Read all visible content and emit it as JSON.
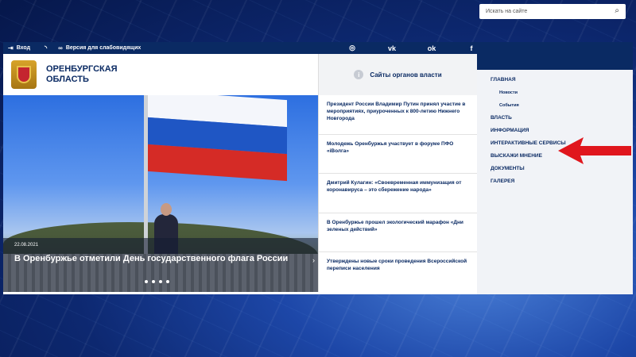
{
  "topbar": {
    "login_label": "Вход",
    "rss_icon": "rss-icon",
    "accessibility_label": "Версия для слабовидящих",
    "socials": [
      "instagram-icon",
      "vk-icon",
      "odnoklassniki-icon",
      "facebook-icon"
    ],
    "socials_glyphs": [
      "◎",
      "vk",
      "ok",
      "f"
    ]
  },
  "search": {
    "placeholder": "Искать на сайте"
  },
  "header": {
    "title_line1": "ОРЕНБУРГСКАЯ",
    "title_line2": "ОБЛАСТЬ",
    "gov_sites_label": "Сайты органов власти"
  },
  "hero": {
    "date": "22.08.2021",
    "title": "В Оренбуржье отметили День государственного флага России",
    "dots": 4
  },
  "news": [
    "Президент России Владимир Путин принял участие в мероприятиях, приуроченных к 800-летию Нижнего Новгорода",
    "Молодежь Оренбуржья участвует в форуме ПФО «iВолга»",
    "Дмитрий Кулагин: «Своевременная иммунизация от коронавируса – это сбережение народа»",
    "В Оренбуржье прошел экологический марафон «Дни зеленых действий»",
    "Утверждены новые сроки проведения Всероссийской переписи населения"
  ],
  "nav": {
    "main": "ГЛАВНАЯ",
    "sub_news": "Новости",
    "sub_events": "События",
    "power": "ВЛАСТЬ",
    "info": "ИНФОРМАЦИЯ",
    "interactive": "ИНТЕРАКТИВНЫЕ СЕРВИСЫ",
    "opinion": "ВЫСКАЖИ МНЕНИЕ",
    "documents": "ДОКУМЕНТЫ",
    "gallery": "ГАЛЕРЕЯ"
  },
  "colors": {
    "brand_navy": "#0a2a63",
    "arrow_red": "#e0161d"
  }
}
